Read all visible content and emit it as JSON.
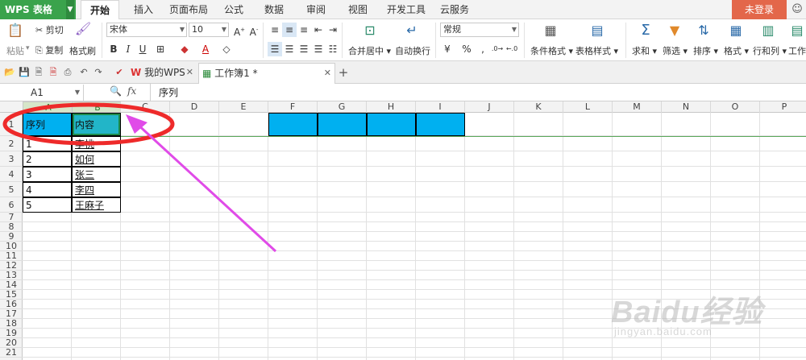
{
  "app": {
    "name": "WPS 表格",
    "login_label": "未登录"
  },
  "menu_tabs": [
    "开始",
    "插入",
    "页面布局",
    "公式",
    "数据",
    "审阅",
    "视图",
    "开发工具",
    "云服务"
  ],
  "ribbon": {
    "clipboard": {
      "paste": "粘贴",
      "cut": "剪切",
      "copy": "复制",
      "format_painter": "格式刷"
    },
    "font": {
      "family": "宋体",
      "size": "10"
    },
    "alignment": {
      "merge_center": "合并居中",
      "wrap_text": "自动换行"
    },
    "number": {
      "format": "常规",
      "percent": "%",
      "thousands": ","
    },
    "styles": {
      "conditional_format": "条件格式",
      "table_style": "表格样式"
    },
    "editing": {
      "sum": "求和",
      "filter": "筛选",
      "sort": "排序",
      "format": "格式",
      "rows_cols": "行和列",
      "worksheet": "工作"
    }
  },
  "document_tabs": [
    {
      "label": "我的WPS",
      "active": false
    },
    {
      "label": "工作簿1 *",
      "active": true
    }
  ],
  "formula_bar": {
    "name_box": "A1",
    "fx": "fx",
    "content": "序列"
  },
  "sheet": {
    "columns": [
      "A",
      "B",
      "C",
      "D",
      "E",
      "F",
      "G",
      "H",
      "I",
      "J",
      "K",
      "L",
      "M",
      "N",
      "O",
      "P"
    ],
    "rows": [
      "1",
      "2",
      "3",
      "4",
      "5",
      "6",
      "7",
      "8",
      "9",
      "10",
      "11",
      "12",
      "13",
      "14",
      "15",
      "16",
      "17",
      "18",
      "19",
      "20",
      "21"
    ],
    "header_row": [
      "序列",
      "内容"
    ],
    "data_rows": [
      [
        "1",
        "李桃"
      ],
      [
        "2",
        "如何"
      ],
      [
        "3",
        "张三"
      ],
      [
        "4",
        "李四"
      ],
      [
        "5",
        "王麻子"
      ]
    ],
    "highlight_color": "#00b0f0",
    "selection_color": "#22b5c8",
    "annotation_color": "#ee2a2a",
    "arrow_color": "#e04be8"
  },
  "watermark": {
    "main": "Baidu经验",
    "sub": "jingyan.baidu.com"
  }
}
